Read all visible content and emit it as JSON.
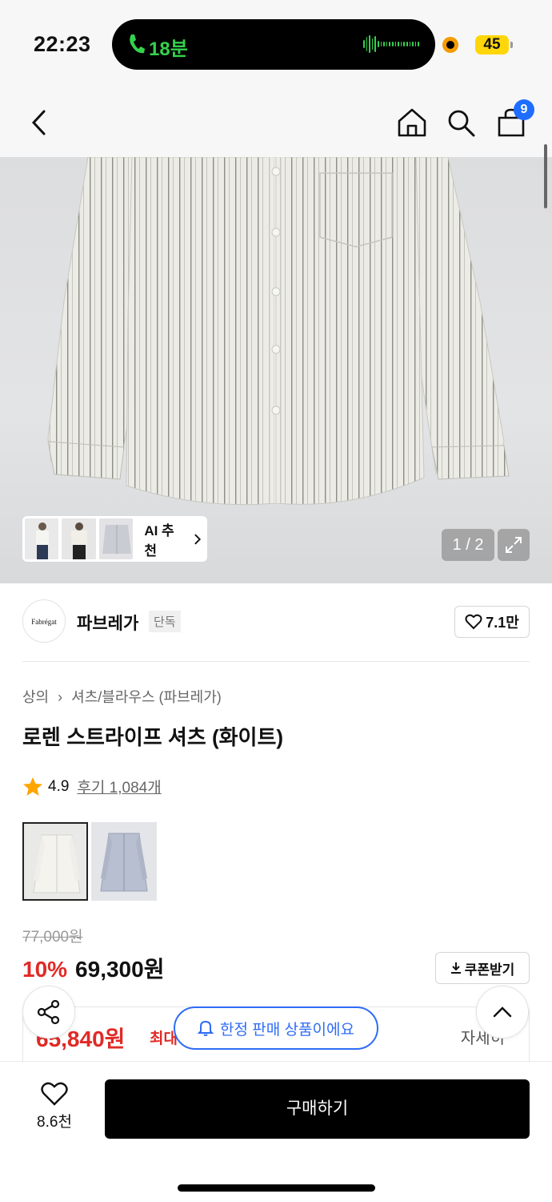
{
  "status": {
    "time": "22:23",
    "call": "18분",
    "battery": "45"
  },
  "nav": {
    "cart_count": "9"
  },
  "gallery": {
    "ai_label": "AI 추천",
    "pager": "1 / 2"
  },
  "brand": {
    "name": "파브레가",
    "tag": "단독",
    "logo_text": "Fabrégat",
    "likes": "7.1만"
  },
  "breadcrumb": {
    "category": "상의",
    "subcategory": "셔츠/블라우스 (파브레가)"
  },
  "product": {
    "title": "로렌 스트라이프 셔츠 (화이트)",
    "rating": "4.9",
    "review_label": "후기 1,084개",
    "colors": [
      "white",
      "blue-gray"
    ]
  },
  "price": {
    "original": "77,000원",
    "discount": "10%",
    "sale": "69,300원",
    "coupon_label": "쿠폰받기",
    "max_price": "65,840원",
    "max_label": "최대",
    "more": "자세히"
  },
  "toast": {
    "limited": "한정 판매 상품이에요"
  },
  "bottom": {
    "likes": "8.6천",
    "buy_label": "구매하기"
  }
}
